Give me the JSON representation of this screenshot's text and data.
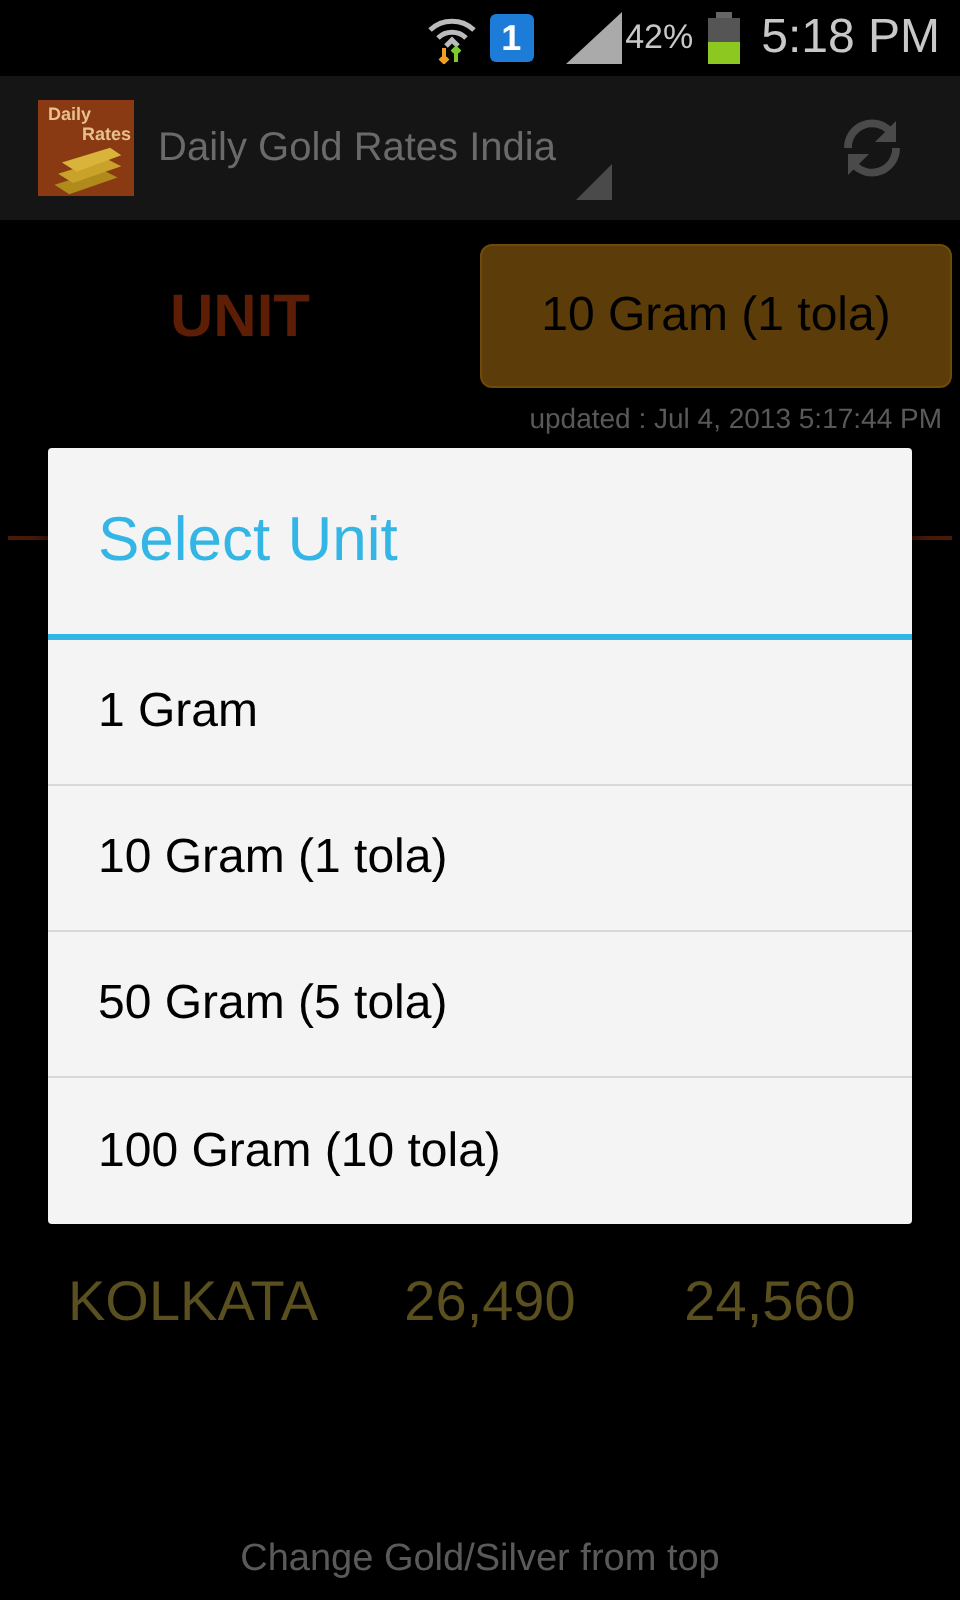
{
  "status_bar": {
    "notification": "1",
    "battery": "42%",
    "time": "5:18 PM"
  },
  "app_bar": {
    "logo_lines": [
      "Daily",
      "Rates"
    ],
    "title": "Daily Gold Rates India"
  },
  "unit": {
    "label": "UNIT",
    "button": "10 Gram (1 tola)",
    "updated": "updated : Jul 4, 2013 5:17:44 PM"
  },
  "rows": [
    {
      "cells": [
        "KOLKATA",
        "26,490",
        "24,560"
      ]
    }
  ],
  "footer": "Change Gold/Silver from top",
  "dialog": {
    "title": "Select Unit",
    "options": [
      "1 Gram",
      "10 Gram (1 tola)",
      "50 Gram (5 tola)",
      "100 Gram (10 tola)"
    ]
  }
}
